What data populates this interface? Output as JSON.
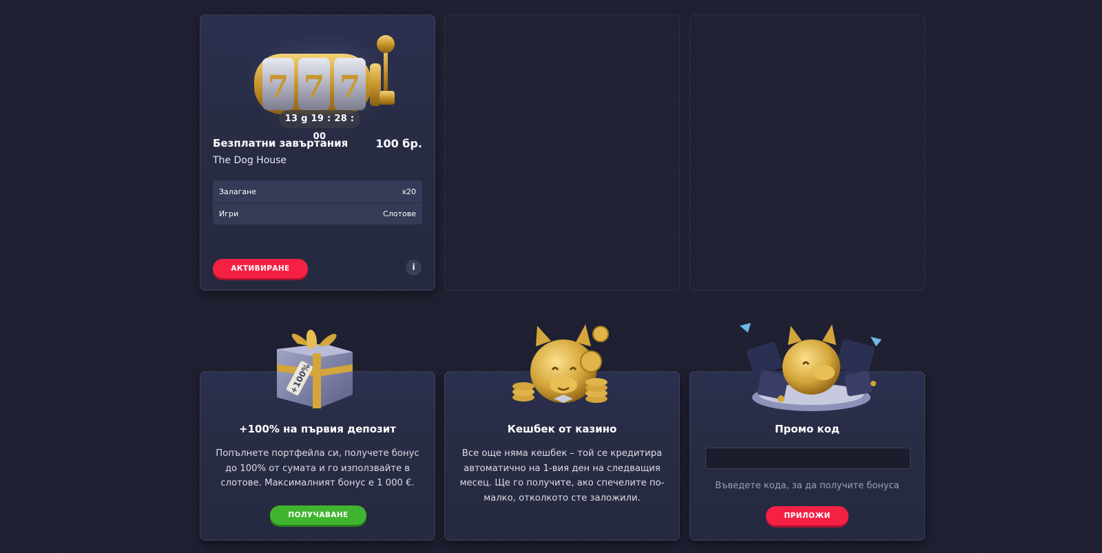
{
  "bonus_card": {
    "timer": "13 g 19 : 28 : 00",
    "title": "Безплатни завъртания",
    "amount": "100 бр.",
    "game": "The Dog House",
    "params": [
      {
        "label": "Залагане",
        "value": "x20"
      },
      {
        "label": "Игри",
        "value": "Слотове"
      }
    ],
    "activate_label": "АКТИВИРАНЕ",
    "info_label": "i"
  },
  "promos": {
    "deposit": {
      "title": "+100% на първия депозит",
      "description": "Попълнете портфейла си, получете бонус до 100% от сумата и го използвайте в слотове. Максималният бонус е 1 000 €.",
      "button": "ПОЛУЧАВАНЕ",
      "gift_tag": "+100%"
    },
    "cashback": {
      "title": "Кешбек от казино",
      "description": "Все още няма кешбек – той се кредитира автоматично на 1-вия ден на следващия месец. Ще го получите, ако спечелите по-малко, отколкото сте заложили."
    },
    "promo_code": {
      "title": "Промо код",
      "input_value": "",
      "hint": "Въведете кода, за да получите бонуса",
      "button": "ПРИЛОЖИ"
    }
  },
  "colors": {
    "background": "#1d1f30",
    "card": "#282c44",
    "accent_red": "#f42145",
    "accent_green": "#3fb52f",
    "gold": "#d4a53a"
  },
  "icons": {
    "slot_machine": "slot-machine-777-image",
    "gift": "gift-box-image",
    "piggy_bank": "piggy-bank-image",
    "piggy_gifts": "piggy-bank-gifts-image",
    "info": "info-icon"
  }
}
